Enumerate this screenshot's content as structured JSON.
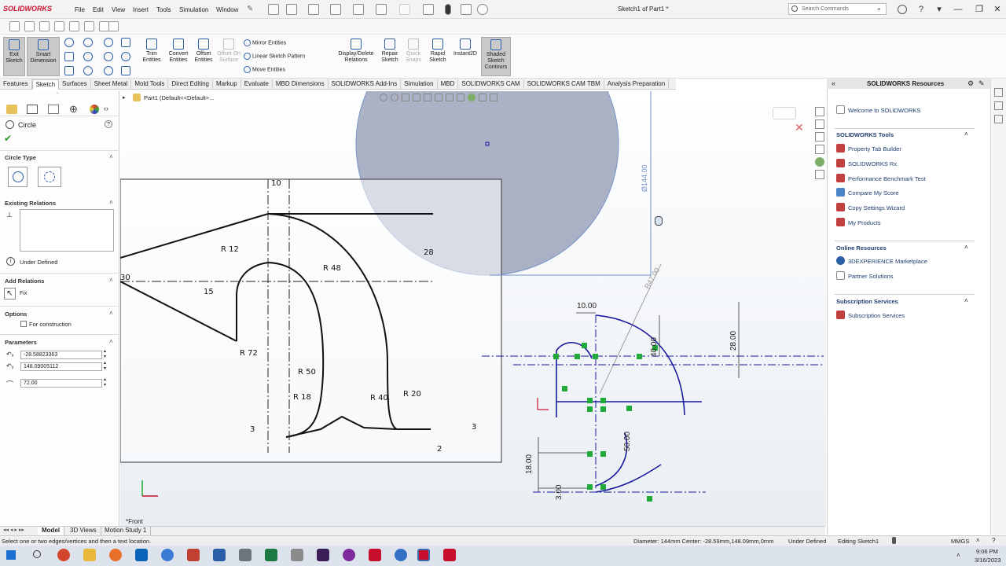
{
  "app": {
    "brand": "SOLIDWORKS",
    "title": "Sketch1 of Part1 *"
  },
  "menu": [
    "File",
    "Edit",
    "View",
    "Insert",
    "Tools",
    "Simulation",
    "Window"
  ],
  "search": {
    "placeholder": "Search Commands"
  },
  "ribbon": {
    "exit_sketch": "Exit Sketch",
    "smart_dimension": "Smart Dimension",
    "trim": "Trim Entities",
    "convert": "Convert Entities",
    "offset": "Offset Entities",
    "offset_surface": "Offset On Surface",
    "mirror": "Mirror Entities",
    "linear_pattern": "Linear Sketch Pattern",
    "move": "Move Entities",
    "display_delete": "Display/Delete Relations",
    "repair": "Repair Sketch",
    "quick_snaps": "Quick Snaps",
    "rapid": "Rapid Sketch",
    "instant2d": "Instant2D",
    "shaded": "Shaded Sketch Contours"
  },
  "tabs": [
    "Features",
    "Sketch",
    "Surfaces",
    "Sheet Metal",
    "Mold Tools",
    "Direct Editing",
    "Markup",
    "Evaluate",
    "MBD Dimensions",
    "SOLIDWORKS Add-Ins",
    "Simulation",
    "MBD",
    "SOLIDWORKS CAM",
    "SOLIDWORKS CAM TBM",
    "Analysis Preparation"
  ],
  "active_tab": "Sketch",
  "property": {
    "title": "Circle",
    "circle_type": "Circle Type",
    "existing_relations": "Existing Relations",
    "under_defined": "Under Defined",
    "add_relations": "Add Relations",
    "fix": "Fix",
    "options": "Options",
    "for_construction": "For construction",
    "parameters": "Parameters",
    "cx": "-28.58823363",
    "cy": "148.09005112",
    "radius": "72.00"
  },
  "tree": {
    "part": "Part1  (Default<<Default>..."
  },
  "drawing": {
    "dims": [
      "10",
      "R 12",
      "R 48",
      "28",
      "30",
      "15",
      "R 72",
      "R 50",
      "R 18",
      "R 40",
      "R 20",
      "3",
      "3",
      "2"
    ]
  },
  "sketch": {
    "dia": "Ø144.00",
    "r": "R47.00",
    "d10": "10.00",
    "d40": "40.00",
    "d28": "28.00",
    "d18": "18.00",
    "d50": "50.00",
    "d3": "3.00",
    "view": "*Front"
  },
  "resources": {
    "title": "SOLIDWORKS Resources",
    "welcome": "Welcome to SOLIDWORKS",
    "tools_title": "SOLIDWORKS Tools",
    "tools": [
      "Property Tab Builder",
      "SOLIDWORKS Rx",
      "Performance Benchmark Test",
      "Compare My Score",
      "Copy Settings Wizard",
      "My Products"
    ],
    "online_title": "Online Resources",
    "online": [
      "3DEXPERIENCE Marketplace",
      "Partner Solutions"
    ],
    "sub_title": "Subscription Services",
    "sub": [
      "Subscription Services"
    ]
  },
  "bottom_tabs": [
    "Model",
    "3D Views",
    "Motion Study 1"
  ],
  "status": {
    "hint": "Select one or two edges/vertices and then a text location.",
    "info": "Diameter: 144mm  Center: -28.59mm,148.09mm,0mm",
    "defined": "Under Defined",
    "editing": "Editing Sketch1",
    "units": "MMGS"
  },
  "clock": {
    "time": "9:06 PM",
    "date": "3/16/2023"
  },
  "colors": {
    "brand": "#c8102e",
    "sketch": "#1a1a9c",
    "relation": "#1faa3a",
    "circle": "#a7aec2"
  }
}
